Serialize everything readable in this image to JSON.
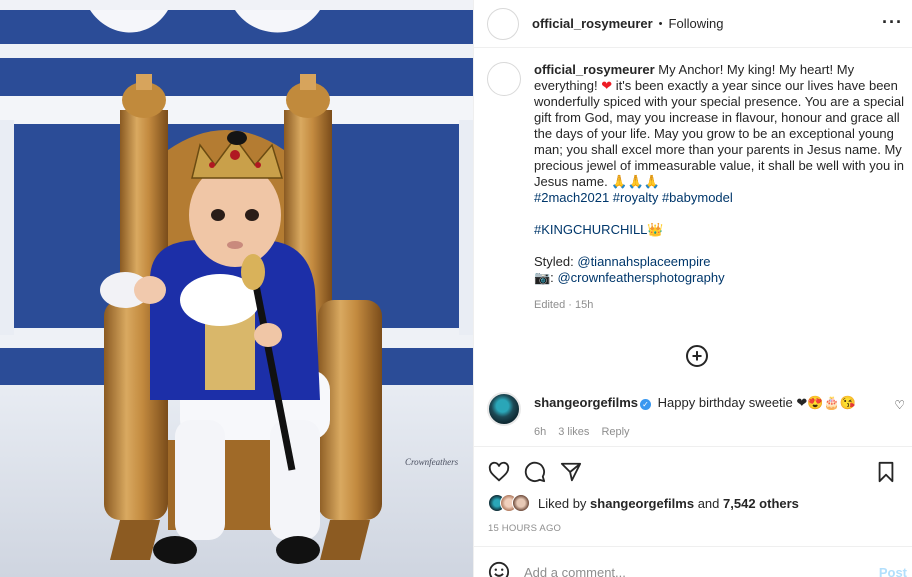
{
  "photo": {
    "watermark": "Crownfeathers"
  },
  "header": {
    "username": "official_rosymeurer",
    "separator": "•",
    "follow_status": "Following",
    "more_icon": "more-horizontal-icon"
  },
  "caption": {
    "username": "official_rosymeurer",
    "text_1": "My Anchor! My king! My heart! My everything!",
    "heart": "❤",
    "text_2": "it's been exactly a year since our lives have been wonderfully spiced with your special presence. You are a special gift from God, may you increase in flavour, honour and grace all the days of your life. May you grow to be an exceptional young man; you shall excel more than your parents in Jesus name. My precious jewel of immeasurable value, it shall be well with you in Jesus name. 🙏🙏🙏",
    "hashtags": [
      "#2mach2021",
      "#royalty",
      "#babymodel"
    ],
    "hashtag_2": "#KINGCHURCHILL",
    "crown": "👑",
    "styled_label": "Styled:",
    "styled_handle": "@tiannahsplaceempire",
    "camera": "📷:",
    "photo_handle": "@crownfeathersphotography",
    "edited": "Edited · 15h"
  },
  "load_more_icon": "plus-circle-icon",
  "comment": {
    "username": "shangeorgefilms",
    "verified": "✓",
    "text": "Happy birthday sweetie ❤😍🎂😘",
    "time": "6h",
    "likes": "3 likes",
    "reply": "Reply",
    "like_icon": "heart-outline-icon"
  },
  "actions": [
    "heart-icon",
    "comment-icon",
    "share-icon",
    "bookmark-icon"
  ],
  "likes": {
    "liked_by": "Liked by",
    "user": "shangeorgefilms",
    "and": "and",
    "others": "7,542 others"
  },
  "timestamp": "15 HOURS AGO",
  "add_comment": {
    "placeholder": "Add a comment...",
    "post": "Post",
    "emoji_icon": "smile-icon"
  },
  "colors": {
    "wall_blue": "#2a4a94",
    "link": "#00376b",
    "verified": "#3897f0",
    "post_disabled": "#b2dffc",
    "heart": "#ed1c24"
  }
}
